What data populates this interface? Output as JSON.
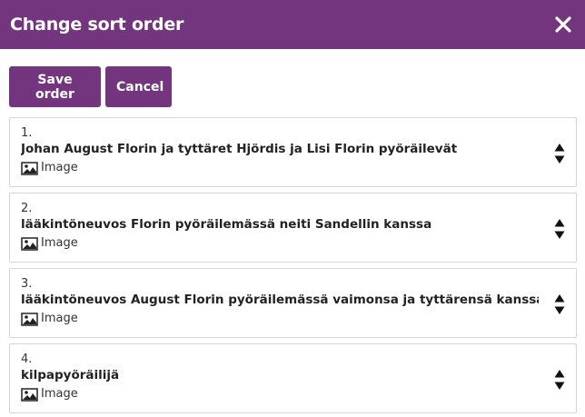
{
  "dialog": {
    "title": "Change sort order",
    "close_icon": "close-icon"
  },
  "toolbar": {
    "save_label": "Save order",
    "cancel_label": "Cancel"
  },
  "items": [
    {
      "number": "1.",
      "title": "Johan August Florin ja tyttäret Hjördis ja Lisi Florin pyöräilevät",
      "type": "Image"
    },
    {
      "number": "2.",
      "title": "lääkintöneuvos Florin pyöräilemässä neiti Sandellin kanssa",
      "type": "Image"
    },
    {
      "number": "3.",
      "title": "lääkintöneuvos August Florin pyöräilemässä vaimonsa ja tyttärensä kanssa",
      "type": "Image"
    },
    {
      "number": "4.",
      "title": "kilpapyöräilijä",
      "type": "Image"
    }
  ],
  "colors": {
    "accent": "#73357e",
    "border": "#d6d6d6"
  }
}
